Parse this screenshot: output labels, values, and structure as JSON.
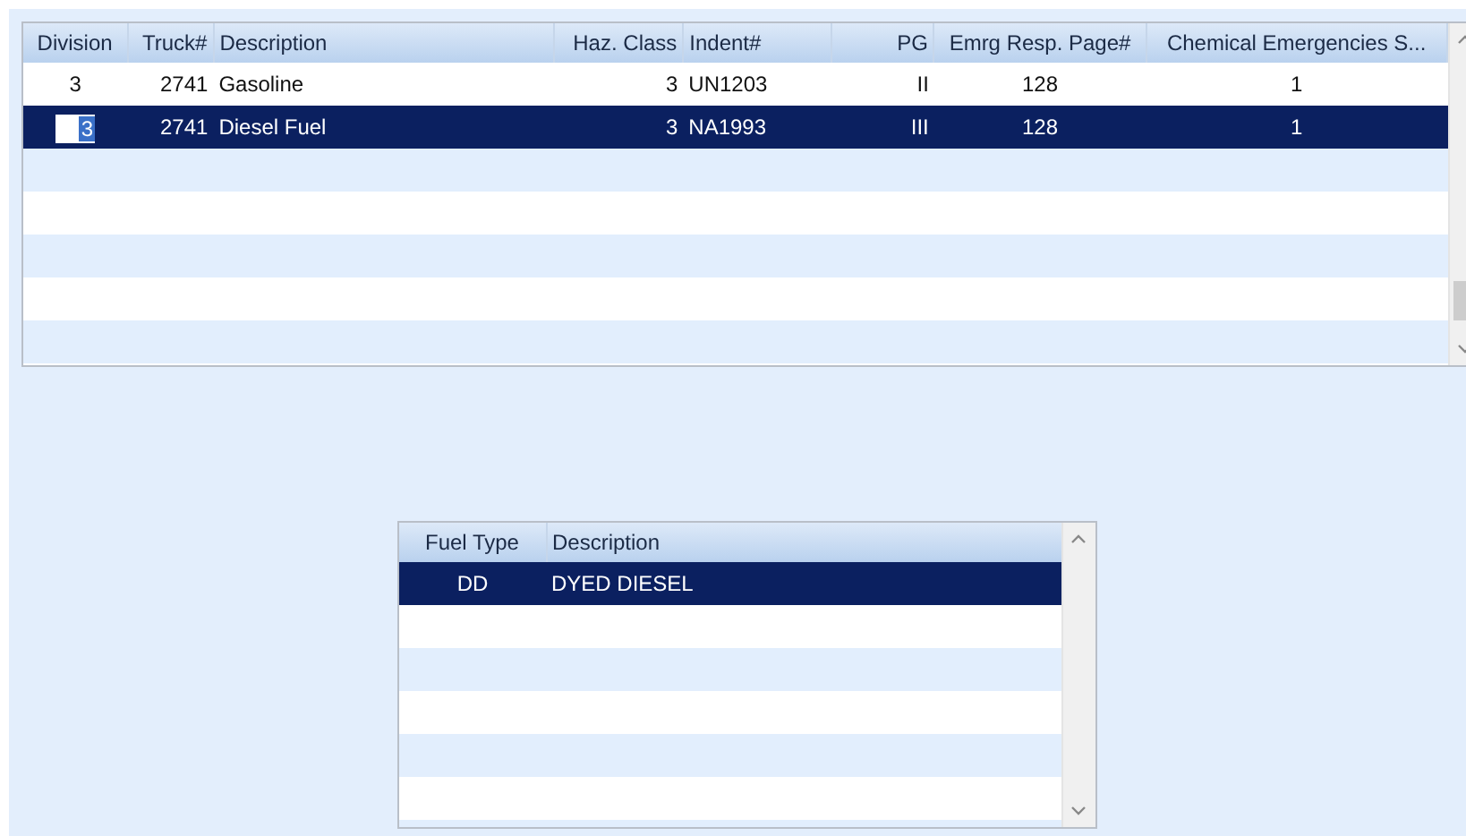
{
  "hazmat_grid": {
    "columns": [
      "Division",
      "Truck#",
      "Description",
      "Haz. Class",
      "Indent#",
      "PG",
      "Emrg Resp. Page#",
      "Chemical Emergencies S..."
    ],
    "rows": [
      {
        "selected": false,
        "editing": false,
        "cells": [
          "3",
          "2741",
          "Gasoline",
          "3",
          "UN1203",
          "II",
          "128",
          "1"
        ]
      },
      {
        "selected": true,
        "editing": true,
        "cells": [
          "3",
          "2741",
          "Diesel Fuel",
          "3",
          "NA1993",
          "III",
          "128",
          "1"
        ]
      }
    ]
  },
  "fuel_grid": {
    "columns": [
      "Fuel Type",
      "Description"
    ],
    "rows": [
      {
        "selected": true,
        "cells": [
          "DD",
          "DYED DIESEL"
        ]
      }
    ]
  }
}
